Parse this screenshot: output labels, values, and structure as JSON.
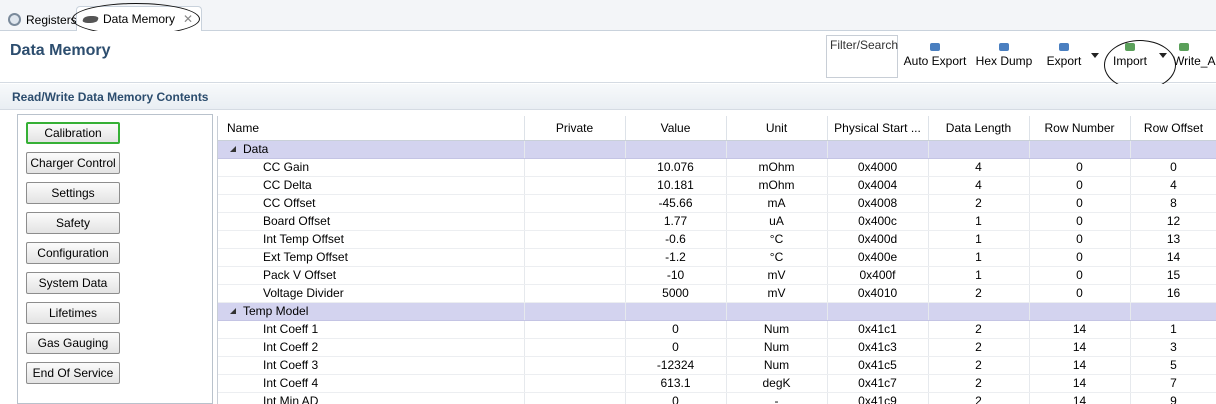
{
  "tabs": [
    {
      "label": "Registers",
      "icon": "gear-icon"
    },
    {
      "label": "Data Memory",
      "icon": "chip-icon",
      "close_icon": "close-icon"
    }
  ],
  "header": {
    "title": "Data Memory",
    "filter_label": "Filter/Search"
  },
  "toolbar": {
    "auto_export": "Auto Export",
    "hex_dump": "Hex Dump",
    "export": "Export",
    "import": "Import",
    "write_all": "Write_A"
  },
  "section": {
    "title": "Read/Write Data Memory Contents"
  },
  "categories": [
    "Calibration",
    "Charger Control",
    "Settings",
    "Safety",
    "Configuration",
    "System Data",
    "Lifetimes",
    "Gas Gauging",
    "End Of Service"
  ],
  "selected_category": "Calibration",
  "table": {
    "columns": [
      "Name",
      "Private",
      "Value",
      "Unit",
      "Physical Start ...",
      "Data Length",
      "Row Number",
      "Row Offset"
    ],
    "groups": [
      {
        "name": "Data",
        "rows": [
          [
            "CC Gain",
            "",
            "10.076",
            "mOhm",
            "0x4000",
            "4",
            "0",
            "0"
          ],
          [
            "CC Delta",
            "",
            "10.181",
            "mOhm",
            "0x4004",
            "4",
            "0",
            "4"
          ],
          [
            "CC Offset",
            "",
            "-45.66",
            "mA",
            "0x4008",
            "2",
            "0",
            "8"
          ],
          [
            "Board Offset",
            "",
            "1.77",
            "uA",
            "0x400c",
            "1",
            "0",
            "12"
          ],
          [
            "Int Temp Offset",
            "",
            "-0.6",
            "°C",
            "0x400d",
            "1",
            "0",
            "13"
          ],
          [
            "Ext Temp Offset",
            "",
            "-1.2",
            "°C",
            "0x400e",
            "1",
            "0",
            "14"
          ],
          [
            "Pack V Offset",
            "",
            "-10",
            "mV",
            "0x400f",
            "1",
            "0",
            "15"
          ],
          [
            "Voltage Divider",
            "",
            "5000",
            "mV",
            "0x4010",
            "2",
            "0",
            "16"
          ]
        ]
      },
      {
        "name": "Temp Model",
        "rows": [
          [
            "Int Coeff 1",
            "",
            "0",
            "Num",
            "0x41c1",
            "2",
            "14",
            "1"
          ],
          [
            "Int Coeff 2",
            "",
            "0",
            "Num",
            "0x41c3",
            "2",
            "14",
            "3"
          ],
          [
            "Int Coeff 3",
            "",
            "-12324",
            "Num",
            "0x41c5",
            "2",
            "14",
            "5"
          ],
          [
            "Int Coeff 4",
            "",
            "613.1",
            "degK",
            "0x41c7",
            "2",
            "14",
            "7"
          ],
          [
            "Int Min AD",
            "",
            "0",
            "-",
            "0x41c9",
            "2",
            "14",
            "9"
          ]
        ]
      }
    ]
  }
}
